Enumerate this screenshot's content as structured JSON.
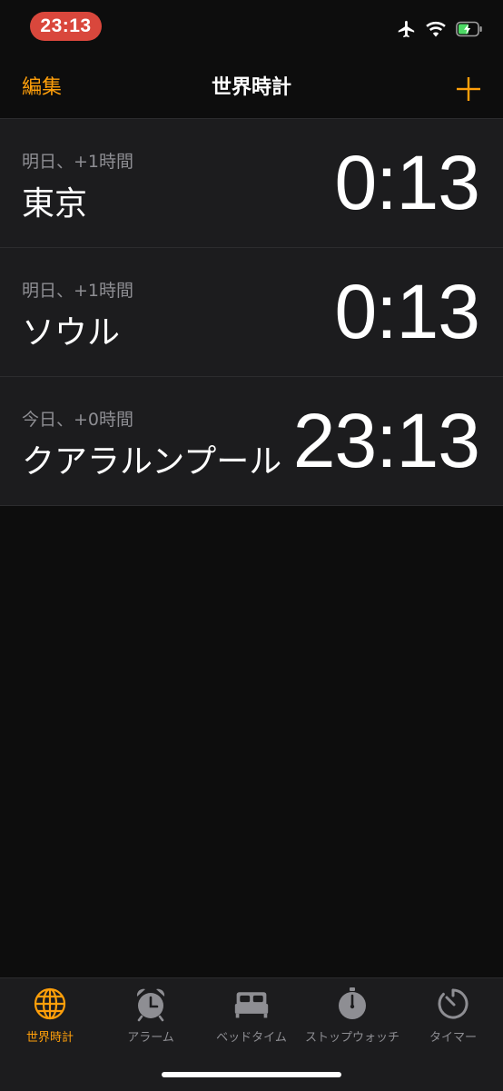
{
  "status_bar": {
    "time": "23:13",
    "icons": [
      "airplane-icon",
      "wifi-icon",
      "battery-charging-icon"
    ]
  },
  "nav": {
    "edit_label": "編集",
    "title": "世界時計",
    "add_icon": "plus-icon"
  },
  "clocks": [
    {
      "offset": "明日、+1時間",
      "city": "東京",
      "time": "0:13"
    },
    {
      "offset": "明日、+1時間",
      "city": "ソウル",
      "time": "0:13"
    },
    {
      "offset": "今日、+0時間",
      "city": "クアラルンプール",
      "time": "23:13"
    }
  ],
  "tabs": [
    {
      "label": "世界時計",
      "icon": "globe-icon",
      "active": true
    },
    {
      "label": "アラーム",
      "icon": "alarm-clock-icon",
      "active": false
    },
    {
      "label": "ベッドタイム",
      "icon": "bed-icon",
      "active": false
    },
    {
      "label": "ストップウォッチ",
      "icon": "stopwatch-icon",
      "active": false
    },
    {
      "label": "タイマー",
      "icon": "timer-icon",
      "active": false
    }
  ],
  "colors": {
    "accent": "#ff9f0a",
    "status_pill": "#d9473c",
    "background": "#0d0d0d",
    "row_background": "#1c1c1e",
    "secondary_text": "#8e8e93",
    "battery_green": "#4cd964"
  }
}
